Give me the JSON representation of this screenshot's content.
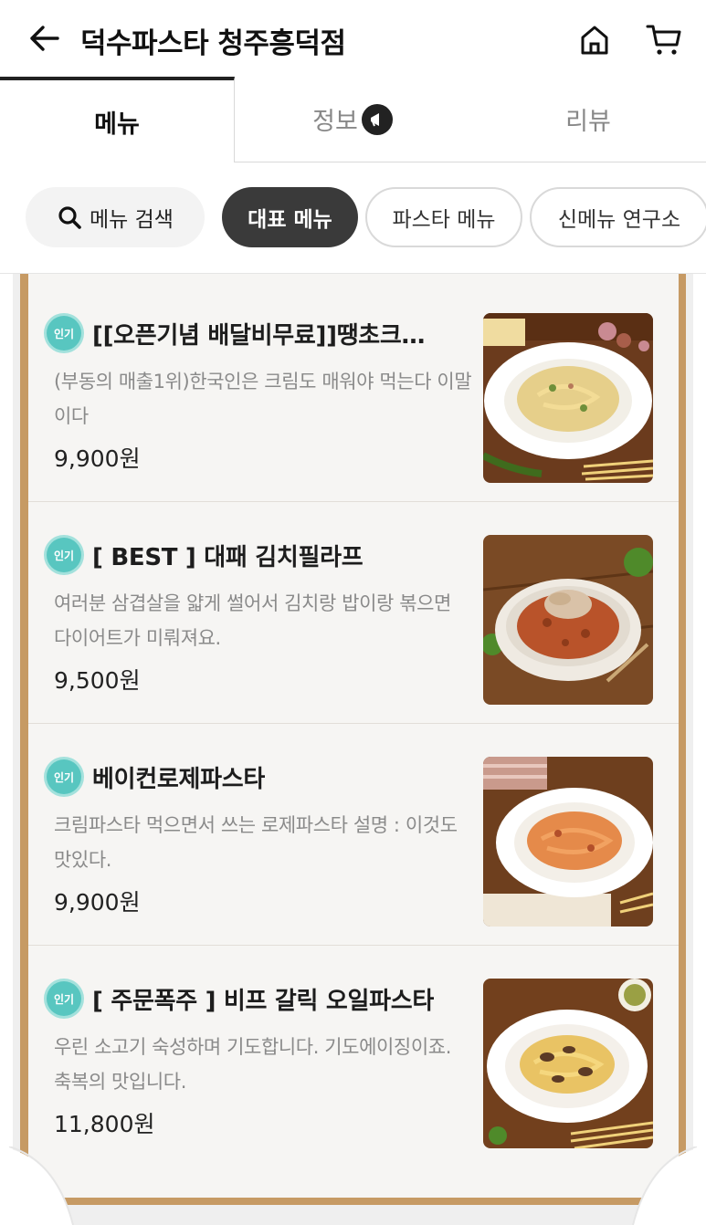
{
  "header": {
    "title": "덕수파스타 청주흥덕점",
    "back_icon": "arrow-left-icon",
    "home_icon": "home-icon",
    "cart_icon": "cart-icon"
  },
  "tabs": [
    {
      "label": "메뉴",
      "active": true
    },
    {
      "label": "정보",
      "icon": "megaphone-icon"
    },
    {
      "label": "리뷰"
    }
  ],
  "chips": {
    "search": "메뉴 검색",
    "items": [
      "대표 메뉴",
      "파스타 메뉴",
      "신메뉴 연구소"
    ],
    "active_index": 0
  },
  "badge_label": "인기",
  "items": [
    {
      "name": "[[오픈기념 배달비무료]]땡초크…",
      "desc": "(부동의 매출1위)한국인은 크림도 매워야 먹는다 이말이다",
      "price": "9,900원"
    },
    {
      "name": "[ BEST ] 대패 김치필라프",
      "desc": "여러분 삼겹살을 얇게 썰어서 김치랑 밥이랑 볶으면 다이어트가 미뤄져요.",
      "price": "9,500원"
    },
    {
      "name": "베이컨로제파스타",
      "desc": "크림파스타 먹으면서 쓰는 로제파스타 설명 : 이것도 맛있다.",
      "price": "9,900원"
    },
    {
      "name": "[ 주문폭주 ] 비프 갈릭 오일파스타",
      "desc": "우린 소고기 숙성하며 기도합니다. 기도에이징이죠. 축복의 맛입니다.",
      "price": "11,800원"
    }
  ],
  "colors": {
    "accent_dark": "#3a3a3a",
    "popular_badge": "#58c6c0",
    "board_frame": "#c69a64"
  }
}
